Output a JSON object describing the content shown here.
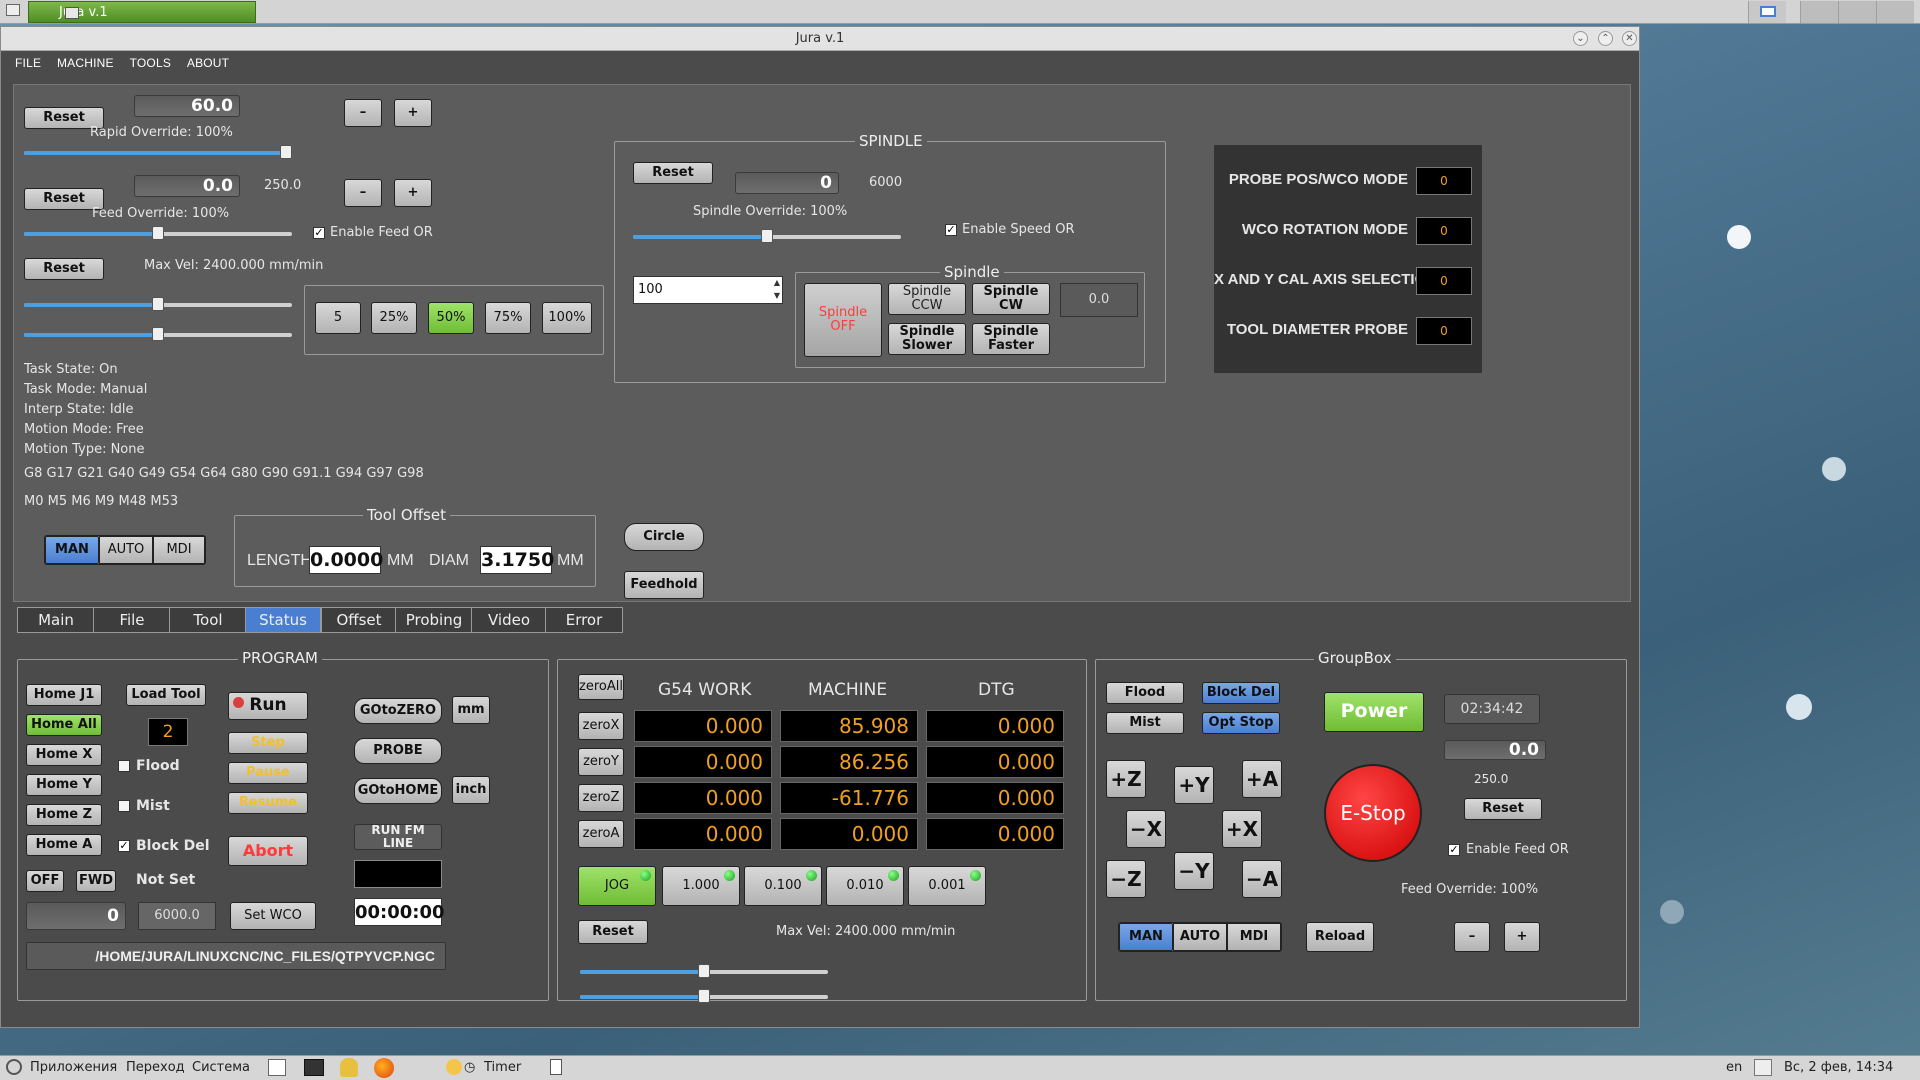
{
  "desktop_taskbar_top": {
    "task_title": "Jura v.1"
  },
  "window": {
    "title": "Jura v.1"
  },
  "menu": [
    "FILE",
    "MACHINE",
    "TOOLS",
    "ABOUT"
  ],
  "overrides": {
    "reset": "Reset",
    "rapid_value": "60.0",
    "rapid_label": "Rapid Override: 100%",
    "rapid_pct": 1.0,
    "feed_value": "0.0",
    "feed_max": "250.0",
    "feed_label": "Feed Override: 100%",
    "feed_pct": 0.5,
    "enable_feed": "Enable Feed OR",
    "max_vel": "Max Vel: 2400.000 mm/min",
    "minus": "–",
    "plus": "+",
    "jog_slider1": 0.5,
    "jog_slider2": 0.5
  },
  "increments": [
    "5",
    "25%",
    "50%",
    "75%",
    "100%"
  ],
  "increments_active": "50%",
  "status": {
    "task_state": "Task State: On",
    "task_mode": "Task Mode:  Manual",
    "interp": "Interp State: Idle",
    "motion_mode": "Motion Mode: Free",
    "motion_type": "Motion Type: None",
    "gcodes": "G8 G17 G21 G40 G49 G54 G64 G80 G90 G91.1 G94 G97 G98",
    "mcodes": "M0 M5 M6 M9 M48 M53"
  },
  "modes": [
    "MAN",
    "AUTO",
    "MDI"
  ],
  "tool_offset": {
    "title": "Tool Offset",
    "length_label": "LENGTH",
    "length": "0.0000",
    "mm": "MM",
    "diam_label": "DIAM",
    "diam": "3.1750"
  },
  "circle": "Circle",
  "feedhold": "Feedhold",
  "spindle": {
    "title": "SPINDLE",
    "reset": "Reset",
    "value": "0",
    "max": "6000",
    "override_label": "Spindle Override: 100%",
    "override_pct": 0.5,
    "enable_speed": "Enable Speed OR",
    "spin_input": "100",
    "sub_title": "Spindle",
    "off": "Spindle OFF",
    "ccw": "Spindle CCW",
    "cw": "Spindle CW",
    "slower": "Spindle Slower",
    "faster": "Spindle Faster",
    "speed_display": "0.0"
  },
  "probe": {
    "rows": [
      {
        "label": "PROBE POS/WCO MODE",
        "value": "0"
      },
      {
        "label": "WCO ROTATION MODE",
        "value": "0"
      },
      {
        "label": "X AND Y CAL AXIS SELECTION",
        "value": "0"
      },
      {
        "label": "TOOL DIAMETER PROBE",
        "value": "0"
      }
    ]
  },
  "tabs": [
    "Main",
    "File",
    "Tool",
    "Status",
    "Offset",
    "Probing",
    "Video",
    "Error"
  ],
  "active_tab": "Status",
  "program": {
    "title": "PROGRAM",
    "home_j1": "Home J1",
    "home_all": "Home All",
    "home_x": "Home X",
    "home_y": "Home Y",
    "home_z": "Home Z",
    "home_a": "Home A",
    "load_tool": "Load Tool",
    "tool_num": "2",
    "flood": "Flood",
    "mist": "Mist",
    "block_del": "Block Del",
    "run": "Run",
    "step": "Step",
    "pause": "Pause",
    "resume": "Resume",
    "abort": "Abort",
    "goto_zero": "GOtoZERO",
    "mm": "mm",
    "probe": "PROBE",
    "goto_home": "GOtoHOME",
    "inch": "inch",
    "run_fm_line": "RUN FM LINE",
    "timer": "00:00:00",
    "off": "OFF",
    "fwd": "FWD",
    "not_set": "Not Set",
    "spindle_val": "0",
    "spindle_set": "6000.0",
    "set_wco": "Set WCO",
    "file_path": "/HOME/JURA/LINUXCNC/NC_FILES/QTPYVCP.NGC"
  },
  "dro": {
    "zero_all": "zeroAll",
    "headers": [
      "G54 WORK",
      "MACHINE",
      "DTG"
    ],
    "rows": [
      {
        "zero": "zeroX",
        "work": "0.000",
        "machine": "85.908",
        "dtg": "0.000"
      },
      {
        "zero": "zeroY",
        "work": "0.000",
        "machine": "86.256",
        "dtg": "0.000"
      },
      {
        "zero": "zeroZ",
        "work": "0.000",
        "machine": "-61.776",
        "dtg": "0.000"
      },
      {
        "zero": "zeroA",
        "work": "0.000",
        "machine": "0.000",
        "dtg": "0.000"
      }
    ],
    "jog": "JOG",
    "steps": [
      "1.000",
      "0.100",
      "0.010",
      "0.001"
    ],
    "reset": "Reset",
    "max_vel": "Max Vel: 2400.000 mm/min",
    "slider1": 0.5,
    "slider2": 0.5
  },
  "groupbox": {
    "title": "GroupBox",
    "flood": "Flood",
    "mist": "Mist",
    "block_del": "Block Del",
    "opt_stop": "Opt Stop",
    "power": "Power",
    "clock": "02:34:42",
    "feed_val": "0.0",
    "feed_max": "250.0",
    "reset": "Reset",
    "enable_feed": "Enable Feed OR",
    "feed_label": "Feed Override: 100%",
    "estop": "E-Stop",
    "jog": {
      "pz": "+Z",
      "py": "+Y",
      "pa": "+A",
      "mx": "−X",
      "px": "+X",
      "mz": "−Z",
      "my": "−Y",
      "ma": "−A"
    },
    "reload": "Reload",
    "minus": "–",
    "plus": "+"
  },
  "taskbar": {
    "apps": "Приложения",
    "go": "Переход",
    "system": "Система",
    "timer": "Timer",
    "lang": "en",
    "clock": "Вс, 2 фев, 14:34"
  }
}
